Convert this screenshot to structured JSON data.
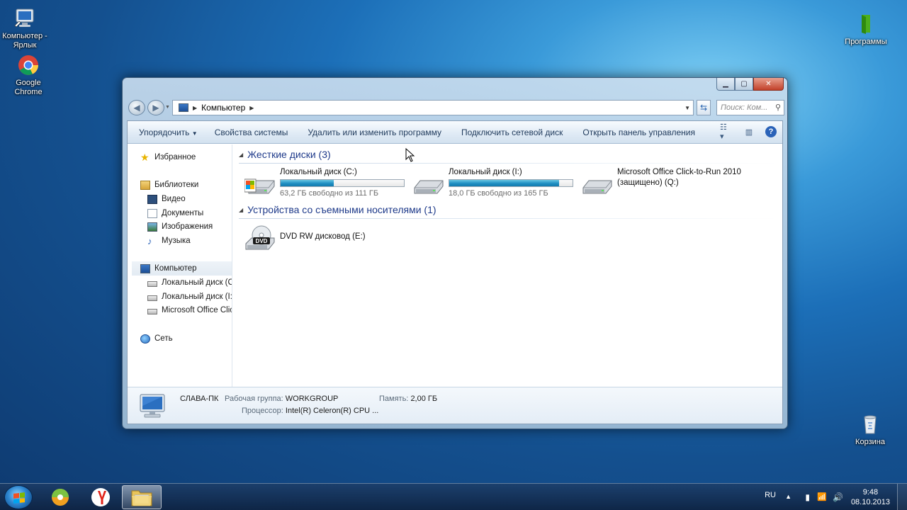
{
  "desktop": {
    "icons": [
      {
        "label": "Компьютер - Ярлык"
      },
      {
        "label": "Google Chrome"
      },
      {
        "label": "Программы"
      },
      {
        "label": "Корзина"
      }
    ]
  },
  "window": {
    "address": {
      "path": "Компьютер"
    },
    "search_placeholder": "Поиск: Ком...",
    "toolbar": {
      "organize": "Упорядочить",
      "system_properties": "Свойства системы",
      "uninstall": "Удалить или изменить программу",
      "map_drive": "Подключить сетевой диск",
      "control_panel": "Открыть панель управления"
    },
    "nav": {
      "favorites": "Избранное",
      "libraries": "Библиотеки",
      "video": "Видео",
      "documents": "Документы",
      "pictures": "Изображения",
      "music": "Музыка",
      "computer": "Компьютер",
      "drive_c": "Локальный диск (C",
      "drive_i": "Локальный диск (I:)",
      "drive_q": "Microsoft Office Clic",
      "network": "Сеть"
    },
    "groups": {
      "hdd": "Жесткие диски (3)",
      "removable": "Устройства со съемными носителями (1)"
    },
    "drives": [
      {
        "name": "Локальный диск (C:)",
        "free": "63,2 ГБ свободно из 111 ГБ",
        "used_fraction": 0.43
      },
      {
        "name": "Локальный диск (I:)",
        "free": "18,0 ГБ свободно из 165 ГБ",
        "used_fraction": 0.89
      },
      {
        "name_line1": "Microsoft Office Click-to-Run 2010",
        "name_line2": "(защищено) (Q:)"
      }
    ],
    "dvd": {
      "name": "DVD RW дисковод (E:)",
      "badge": "DVD"
    },
    "details": {
      "pc_name": "СЛАВА-ПК",
      "workgroup_label": "Рабочая группа:",
      "workgroup_value": "WORKGROUP",
      "memory_label": "Память:",
      "memory_value": "2,00 ГБ",
      "cpu_label": "Процессор:",
      "cpu_value": "Intel(R) Celeron(R) CPU ..."
    }
  },
  "taskbar": {
    "lang": "RU",
    "time": "9:48",
    "date": "08.10.2013"
  }
}
